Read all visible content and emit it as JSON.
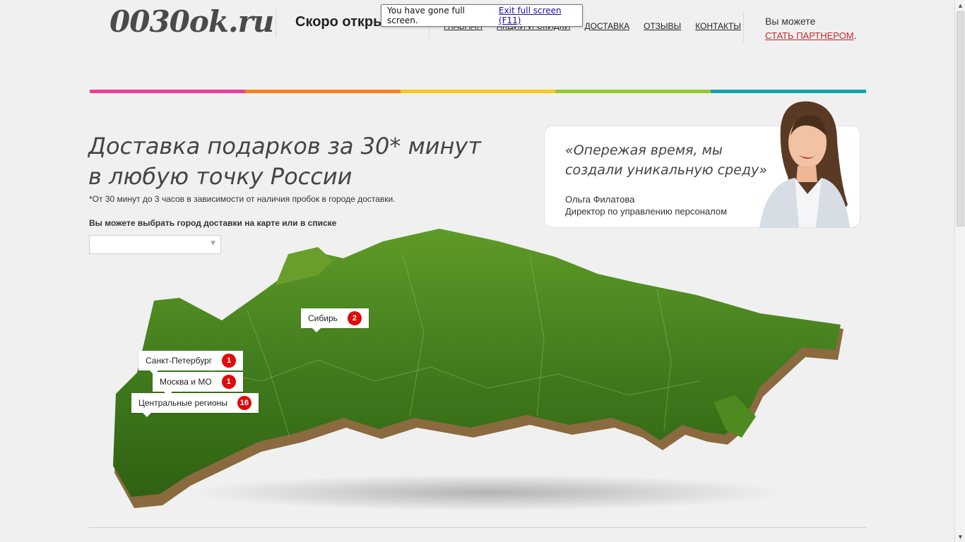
{
  "header": {
    "logo": "0030ok.ru",
    "tagline": "Скоро откры",
    "nav": [
      "Главная",
      "Акции и скидки",
      "Доставка",
      "Отзывы",
      "Контакты"
    ],
    "partner_text": "Вы можете",
    "partner_link": "СТАТЬ ПАРТНЕРОМ",
    "partner_suffix": "."
  },
  "fullscreen_notice": {
    "message": "You have gone full screen.",
    "exit_link": "Exit full screen (F11)"
  },
  "colors": {
    "bar": [
      "#f03c96",
      "#f7821e",
      "#f7c81e",
      "#96c832",
      "#14a5aa"
    ],
    "badge": "#e00a0a",
    "link_red": "#c9262c"
  },
  "hero": {
    "title_line1": "Доставка подарков за 30* минут",
    "title_line2": "в любую точку России",
    "note": "*От 30 минут до 3 часов в зависимости от наличия пробок в городе доставки.",
    "choose_label": "Вы можете выбрать город доставки на карте или в списке",
    "select_value": ""
  },
  "quote": {
    "text": "«Опережая время, мы создали уникальную среду»",
    "author_name": "Ольга Филатова",
    "author_title": "Директор по управлению персоналом"
  },
  "regions": [
    {
      "name": "Сибирь",
      "count": "2"
    },
    {
      "name": "Санкт-Петербург",
      "count": "1"
    },
    {
      "name": "Москва и МО",
      "count": "1"
    },
    {
      "name": "Центральные регионы",
      "count": "16"
    }
  ]
}
